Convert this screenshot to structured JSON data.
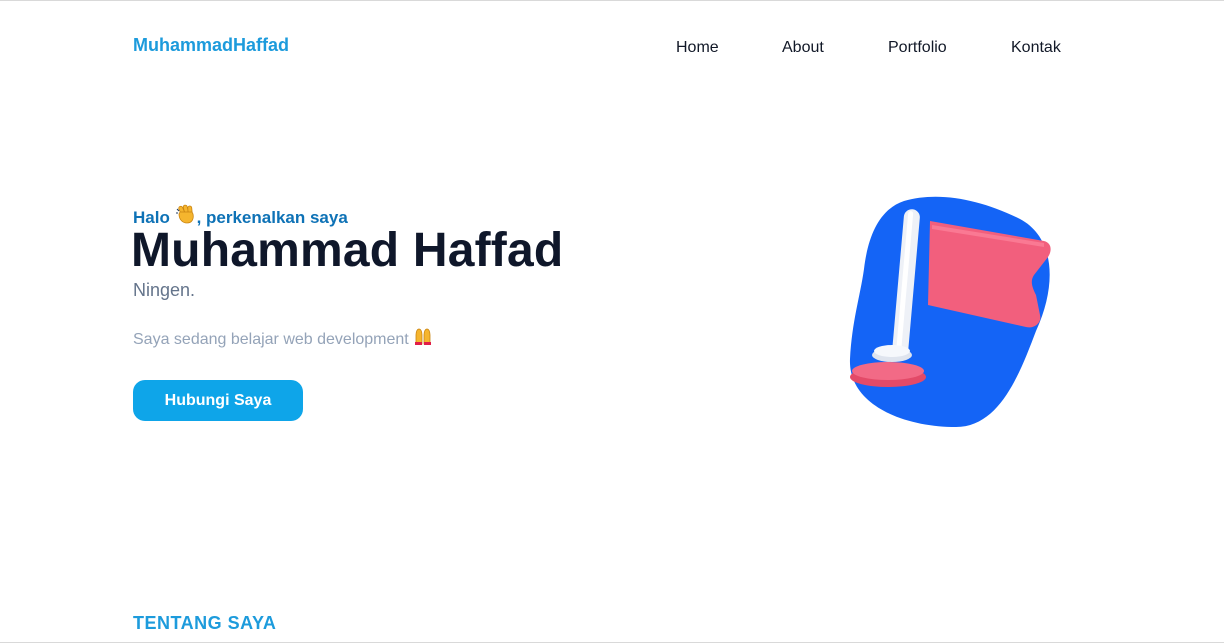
{
  "header": {
    "brand": "MuhammadHaffad",
    "nav": {
      "home": "Home",
      "about": "About",
      "portfolio": "Portfolio",
      "kontak": "Kontak"
    }
  },
  "hero": {
    "greeting_prefix": "Halo",
    "greeting_suffix": ", perkenalkan saya",
    "name": "Muhammad Haffad",
    "subtitle": "Ningen.",
    "description": "Saya sedang belajar web development",
    "cta_label": "Hubungi Saya",
    "illustration": "flag-illustration"
  },
  "sections": {
    "about_heading": "TENTANG SAYA"
  },
  "colors": {
    "brand": "#1d9bdc",
    "greeting": "#0e72b6",
    "button": "#0ea5e9",
    "blob": "#1464f6",
    "flag": "#f25f7d"
  }
}
